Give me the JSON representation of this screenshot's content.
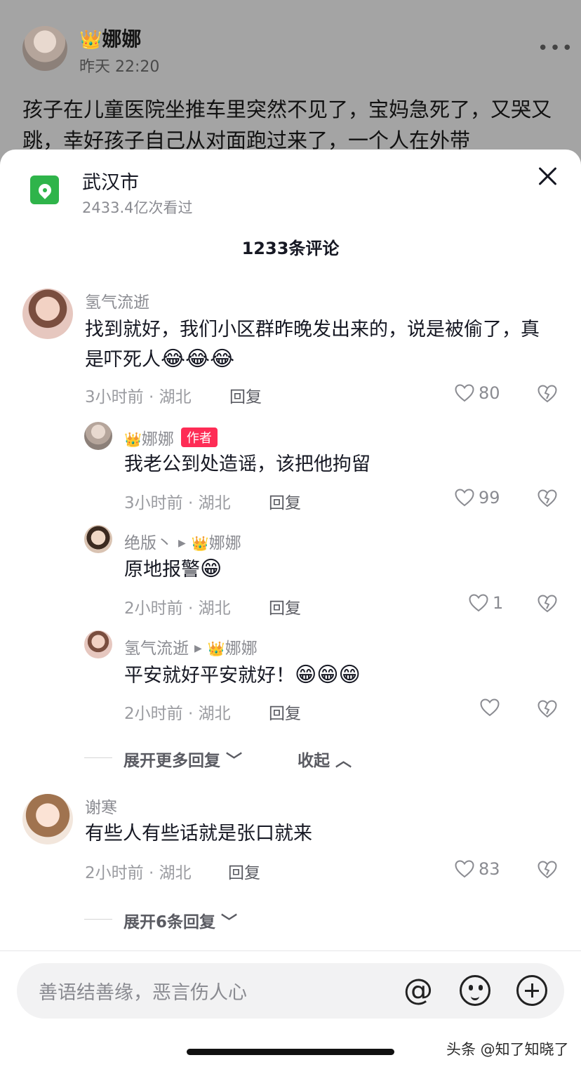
{
  "background_post": {
    "crown": "👑",
    "author": "娜娜",
    "time": "昨天 22:20",
    "more": "•••",
    "text": "孩子在儿童医院坐推车里突然不见了，宝妈急死了，又哭又跳，幸好孩子自己从对面跑过来了，一个人在外带"
  },
  "location": {
    "name": "武汉市",
    "views": "2433.4亿次看过"
  },
  "comment_count": "1233条评论",
  "comments": [
    {
      "user": "氢气流逝",
      "text": "找到就好，我们小区群昨晚发出来的，说是被偷了，真是吓死人",
      "emoji": "😂😂😂",
      "meta": "3小时前 · 湖北",
      "reply": "回复",
      "likes": "80",
      "replies": [
        {
          "crown": "👑",
          "user": "娜娜",
          "tag": "作者",
          "text": "我老公到处造谣，该把他拘留",
          "meta": "3小时前 · 湖北",
          "reply": "回复",
          "likes": "99"
        },
        {
          "user": "绝版丶",
          "arrow": "▶",
          "crown": "👑",
          "to": "娜娜",
          "text": "原地报警",
          "emoji": "😁",
          "meta": "2小时前 · 湖北",
          "reply": "回复",
          "likes": "1"
        },
        {
          "user": "氢气流逝",
          "arrow": "▶",
          "crown": "👑",
          "to": "娜娜",
          "text": "平安就好平安就好！",
          "emoji": "😁😁😁",
          "meta": "2小时前 · 湖北",
          "reply": "回复",
          "likes": ""
        }
      ],
      "expand_more": "展开更多回复",
      "collapse": "收起"
    },
    {
      "user": "谢寒",
      "text": "有些人有些话就是张口就来",
      "meta": "2小时前 · 湖北",
      "reply": "回复",
      "likes": "83",
      "expand": "展开6条回复"
    }
  ],
  "input": {
    "placeholder": "善语结善缘，恶言伤人心",
    "at_symbol": "@"
  },
  "watermark": "头条 @知了知晓了",
  "icons": [
    "location-pin-icon",
    "close-icon",
    "heart-icon",
    "dislike-icon",
    "at-icon",
    "emoji-icon",
    "plus-icon"
  ],
  "colors": {
    "accent_red": "#fe2c55",
    "location_green": "#2fb44a"
  }
}
